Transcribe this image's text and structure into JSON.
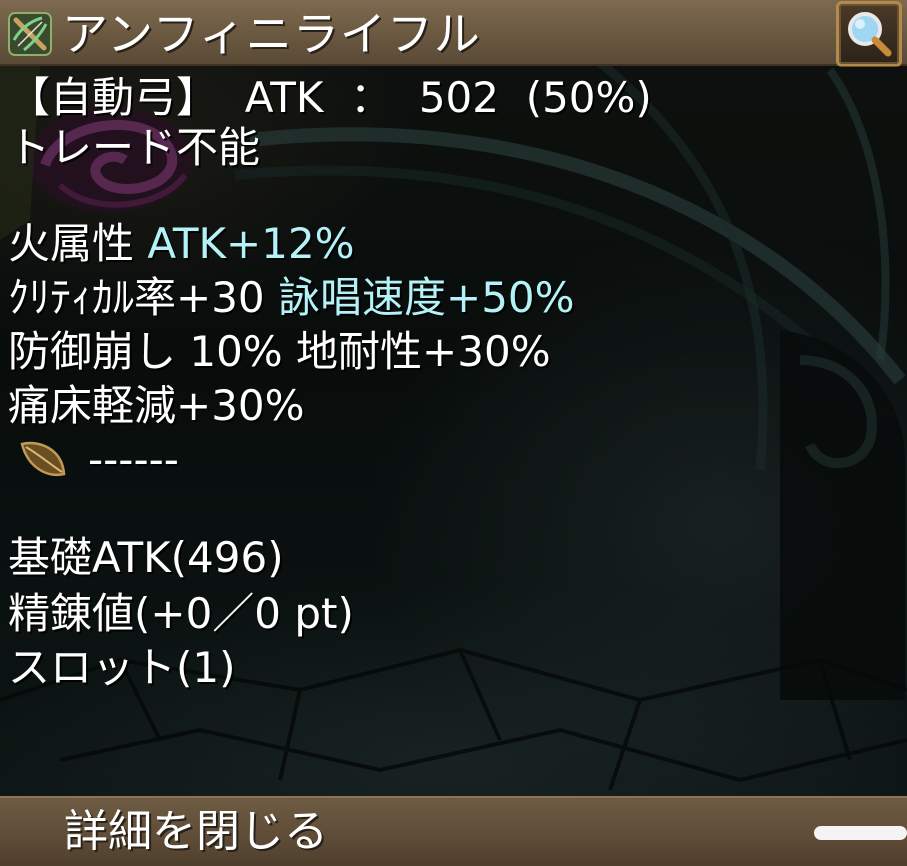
{
  "window": {
    "title": "アンフィニライフル",
    "icons": {
      "item_type": "crossbow-icon",
      "search": "magnifier-icon"
    }
  },
  "item": {
    "header": {
      "category": "【自動弓】",
      "atk_label": "ATK",
      "separator": "：",
      "atk_value": "502",
      "atk_percent": "(50%)"
    },
    "trade": "トレード不能",
    "effects": [
      {
        "parts": [
          {
            "text": "火属性 ",
            "color": "#ffffff"
          },
          {
            "text": "ATK+12%",
            "color": "#b4f2f8"
          }
        ]
      },
      {
        "parts": [
          {
            "text": "ｸﾘﾃｨｶﾙ率+30 ",
            "color": "#ffffff"
          },
          {
            "text": "詠唱速度+50%",
            "color": "#b4f2f8"
          }
        ]
      },
      {
        "parts": [
          {
            "text": "防御崩し 10% 地耐性+30%",
            "color": "#ffffff"
          }
        ]
      },
      {
        "parts": [
          {
            "text": "痛床軽減+30%",
            "color": "#ffffff"
          }
        ]
      }
    ],
    "slot": {
      "icon": "slot-leaf-icon",
      "text": "------"
    },
    "stats": {
      "base_atk": "基礎ATK(496)",
      "refine": "精錬値(+0／0 pt)",
      "slots": "スロット(1)"
    }
  },
  "footer": {
    "close_label": "詳細を閉じる"
  },
  "colors": {
    "title_bar": "#6a5840",
    "highlight_text": "#b4f2f8",
    "normal_text": "#ffffff",
    "button_border": "#b38a4a"
  }
}
